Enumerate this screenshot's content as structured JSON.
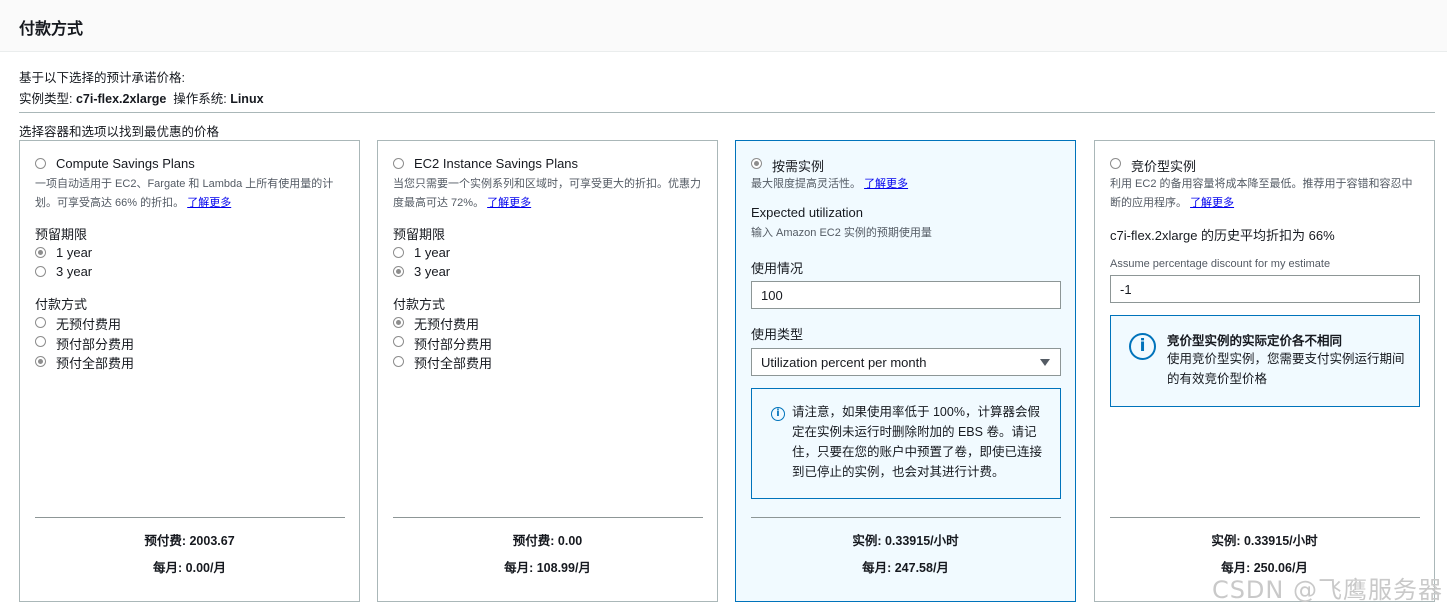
{
  "header": {
    "title": "付款方式"
  },
  "intro": {
    "line1": "基于以下选择的预计承诺价格:",
    "instance_type_label": "实例类型: ",
    "instance_type_value": "c7i-flex.2xlarge",
    "os_label": "  操作系统: ",
    "os_value": "Linux"
  },
  "section_label": "选择容器和选项以找到最优惠的价格",
  "cards": {
    "compute": {
      "title": "Compute Savings Plans",
      "selected": false,
      "desc": "一项自动适用于 EC2、Fargate 和 Lambda 上所有使用量的计划。可享受高达 66% 的折扣。",
      "learn_more": "了解更多",
      "term_label": "预留期限",
      "term_options": [
        {
          "label": "1 year",
          "checked": true
        },
        {
          "label": "3 year",
          "checked": false
        }
      ],
      "payment_label": "付款方式",
      "payment_options": [
        {
          "label": "无预付费用",
          "checked": false
        },
        {
          "label": "预付部分费用",
          "checked": false
        },
        {
          "label": "预付全部费用",
          "checked": true
        }
      ],
      "footer_line1": "预付费: 2003.67",
      "footer_line2": "每月: 0.00/月"
    },
    "ec2": {
      "title": "EC2 Instance Savings Plans",
      "selected": false,
      "desc": "当您只需要一个实例系列和区域时，可享受更大的折扣。优惠力度最高可达 72%。",
      "learn_more": "了解更多",
      "term_label": "预留期限",
      "term_options": [
        {
          "label": "1 year",
          "checked": false
        },
        {
          "label": "3 year",
          "checked": true
        }
      ],
      "payment_label": "付款方式",
      "payment_options": [
        {
          "label": "无预付费用",
          "checked": true
        },
        {
          "label": "预付部分费用",
          "checked": false
        },
        {
          "label": "预付全部费用",
          "checked": false
        }
      ],
      "footer_line1": "预付费: 0.00",
      "footer_line2": "每月: 108.99/月"
    },
    "ondemand": {
      "title": "按需实例",
      "selected": true,
      "desc": "最大限度提高灵活性。",
      "learn_more": "了解更多",
      "expected_label": "Expected utilization",
      "expected_desc": "输入 Amazon EC2 实例的预期使用量",
      "usage_label": "使用情况",
      "usage_value": "100",
      "usage_type_label": "使用类型",
      "usage_type_value": "Utilization percent per month",
      "info_text": "请注意，如果使用率低于 100%，计算器会假定在实例未运行时删除附加的 EBS 卷。请记住，只要在您的账户中预置了卷，即使已连接到已停止的实例，也会对其进行计费。",
      "footer_line1": "实例: 0.33915/小时",
      "footer_line2": "每月: 247.58/月"
    },
    "spot": {
      "title": "竞价型实例",
      "selected": false,
      "desc": "利用 EC2 的备用容量将成本降至最低。推荐用于容错和容忍中断的应用程序。",
      "learn_more": "了解更多",
      "avg_discount_text": "c7i-flex.2xlarge 的历史平均折扣为 66%",
      "assume_label": "Assume percentage discount for my estimate",
      "assume_value": "-1",
      "info_title": "竞价型实例的实际定价各不相同",
      "info_text": "使用竞价型实例，您需要支付实例运行期间的有效竞价型价格",
      "footer_line1": "实例: 0.33915/小时",
      "footer_line2": "每月: 250.06/月"
    }
  },
  "watermark": "CSDN @飞鹰服务器",
  "colors": {
    "accent": "#0073bb",
    "selected_bg": "#f1faff",
    "link": "#0000ee"
  },
  "icons": {
    "info": "info-circle-icon"
  }
}
